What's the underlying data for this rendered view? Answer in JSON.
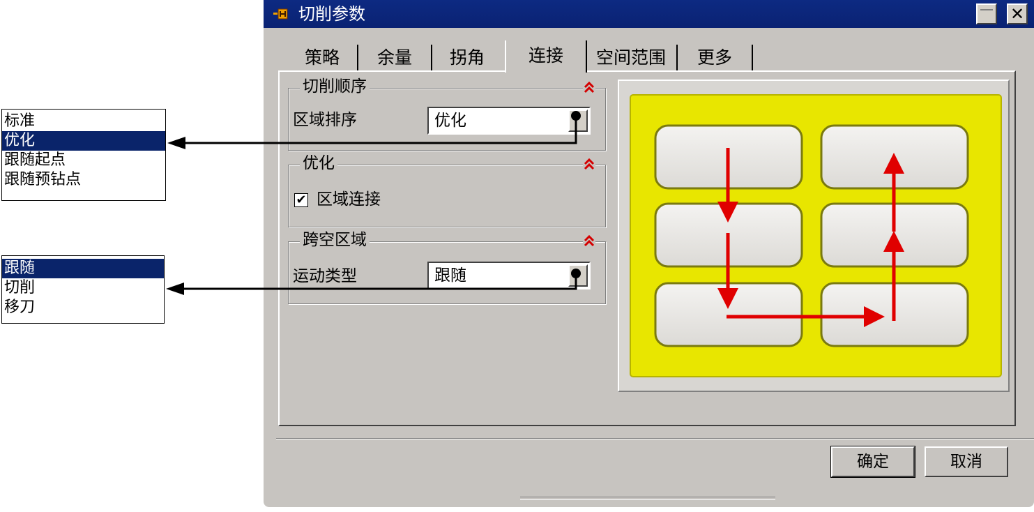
{
  "dialog": {
    "title": "切削参数",
    "icon": "dialog-app-icon",
    "minimize_icon": "minimize-icon",
    "close_icon": "close-icon",
    "close_glyph": "✕"
  },
  "tabs": [
    {
      "label": "策略",
      "active": false
    },
    {
      "label": "余量",
      "active": false
    },
    {
      "label": "拐角",
      "active": false
    },
    {
      "label": "连接",
      "active": true
    },
    {
      "label": "空间范围",
      "active": false
    },
    {
      "label": "更多",
      "active": false
    }
  ],
  "groups": {
    "cut_order": {
      "title": "切削顺序",
      "field_label": "区域排序",
      "field_value": "优化"
    },
    "optimize": {
      "title": "优化",
      "checkbox_label": "区域连接",
      "checked": true,
      "check_glyph": "✔"
    },
    "span_region": {
      "title": "跨空区域",
      "field_label": "运动类型",
      "field_value": "跟随"
    }
  },
  "buttons": {
    "ok": "确定",
    "cancel": "取消"
  },
  "region_order_options": [
    {
      "label": "标准",
      "selected": false
    },
    {
      "label": "优化",
      "selected": true
    },
    {
      "label": "跟随起点",
      "selected": false
    },
    {
      "label": "跟随预钻点",
      "selected": false
    }
  ],
  "motion_type_options": [
    {
      "label": "跟随",
      "selected": true
    },
    {
      "label": "切削",
      "selected": false
    },
    {
      "label": "移刀",
      "selected": false
    }
  ],
  "colors": {
    "dialog_bg": "#c7c4c0",
    "title_bar": "#0d2a82",
    "selection": "#0a246a",
    "preview_frame": "#e8e600",
    "arrow": "#e00000",
    "collapse_chevron": "#d40000"
  }
}
